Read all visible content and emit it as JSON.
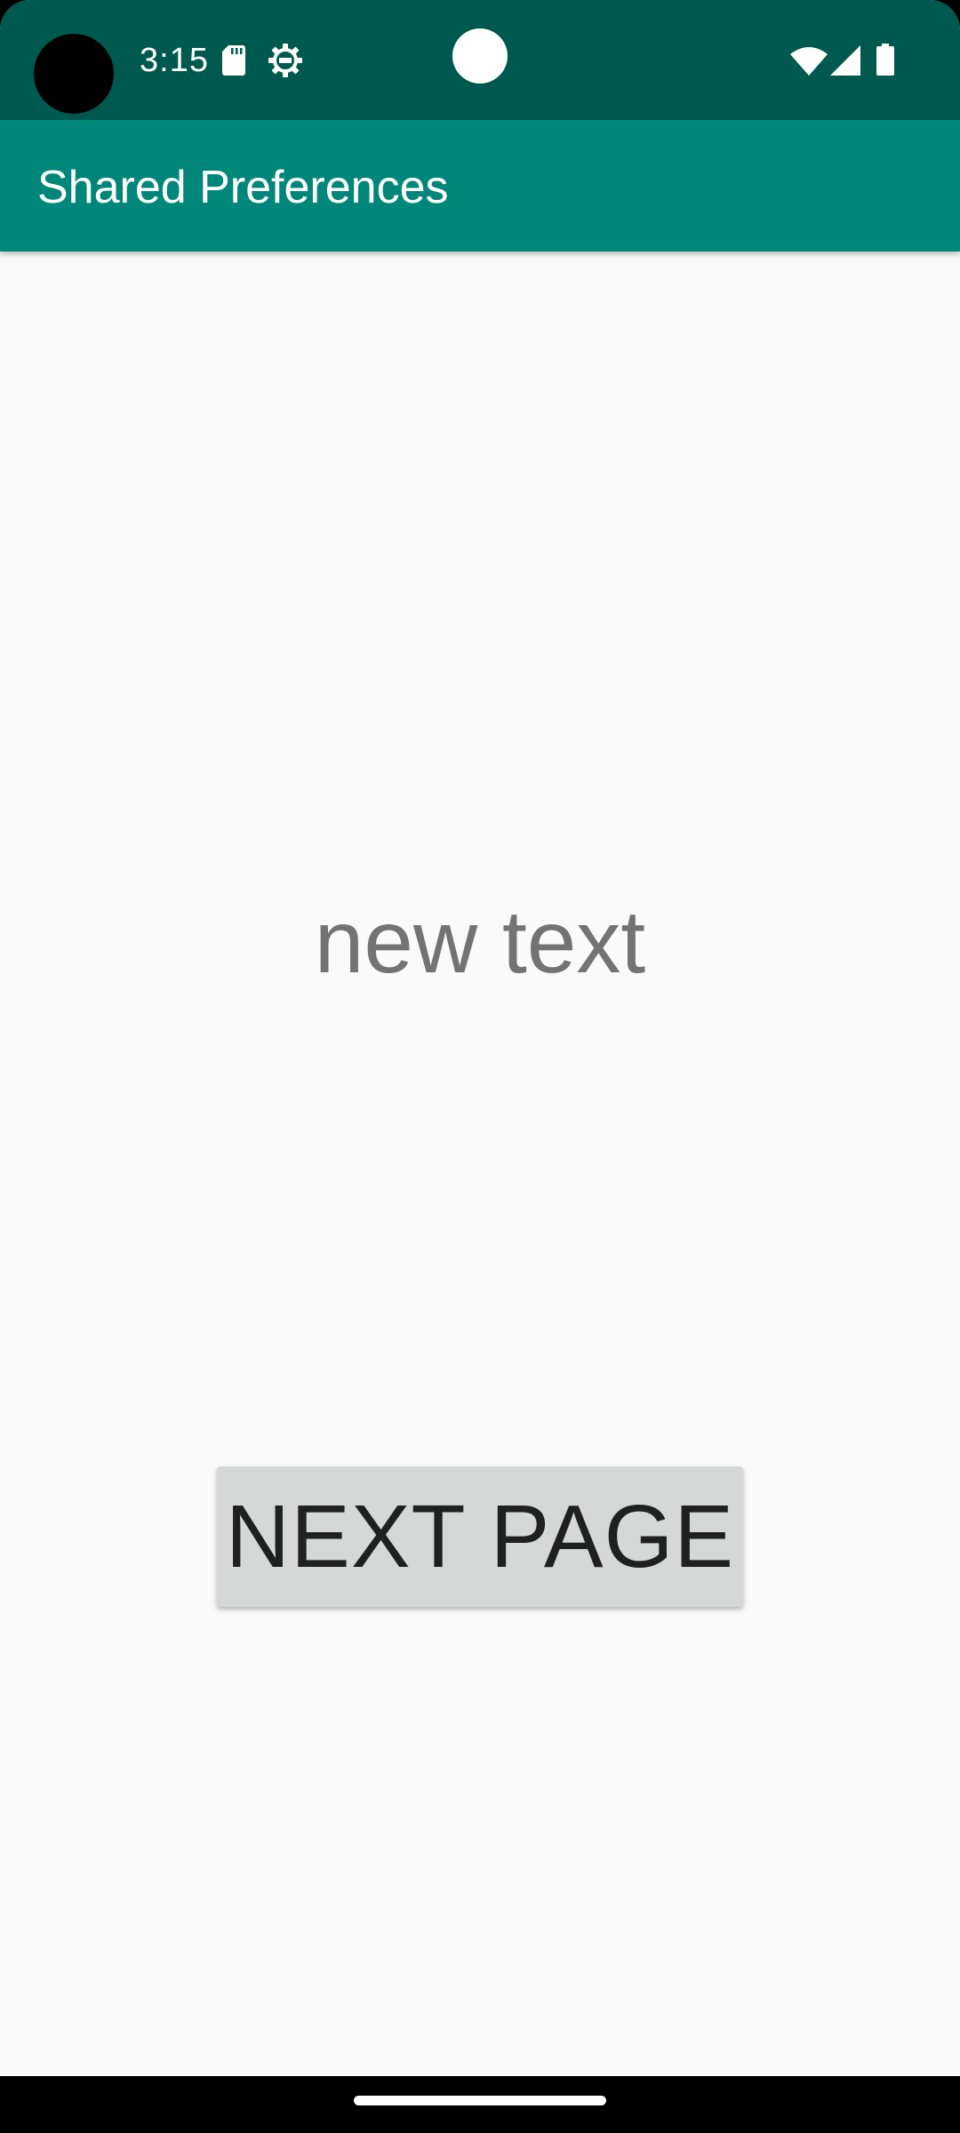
{
  "status_bar": {
    "time": "3:15",
    "icons": [
      "sd-card-icon",
      "gear-icon",
      "wifi-icon",
      "signal-icon",
      "battery-icon"
    ],
    "background_color": "#00594f"
  },
  "app_bar": {
    "title": "Shared Preferences",
    "background_color": "#00877a"
  },
  "main": {
    "text": "new text",
    "button_label": "NEXT PAGE"
  }
}
